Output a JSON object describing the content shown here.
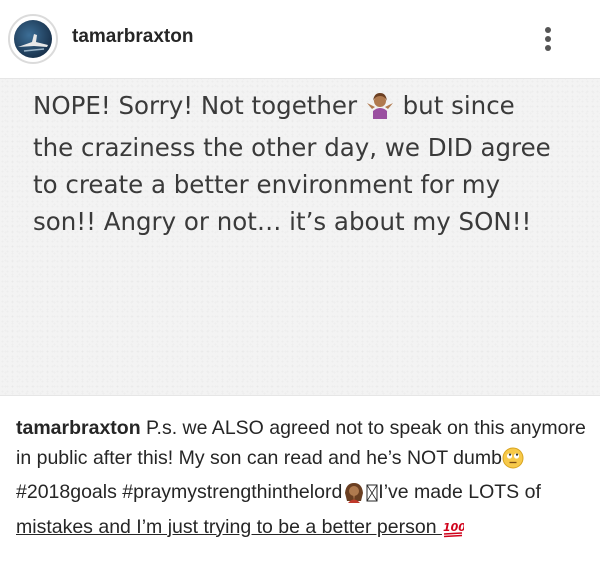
{
  "post": {
    "username": "tamarbraxton"
  },
  "image_text": {
    "line1_a": "NOPE! Sorry! Not together ",
    "line1_b": " but since",
    "line2": "the craziness the other day, we DID agree",
    "line3": "to create a better environment for my",
    "line4": "son!! Angry or not… it’s about my SON!!"
  },
  "caption": {
    "username": "tamarbraxton",
    "seg1": " P.s. we ALSO agreed not to speak on this anymore in public after this! My son can read and he’s NOT dumb",
    "seg2": " #2018goals #praymystrengthinthelord",
    "seg3": "I’ve made LOTS of ",
    "seg4": "mistakes and I’m just trying to be a better person "
  },
  "icons": {
    "avatar": "profile-photo",
    "more": "more-vertical-icon",
    "emoji1": "woman-shrugging-emoji",
    "emoji2": "rolling-eyes-emoji",
    "emoji3": "woman-praying-emoji",
    "emoji4": "hundred-points-emoji"
  }
}
